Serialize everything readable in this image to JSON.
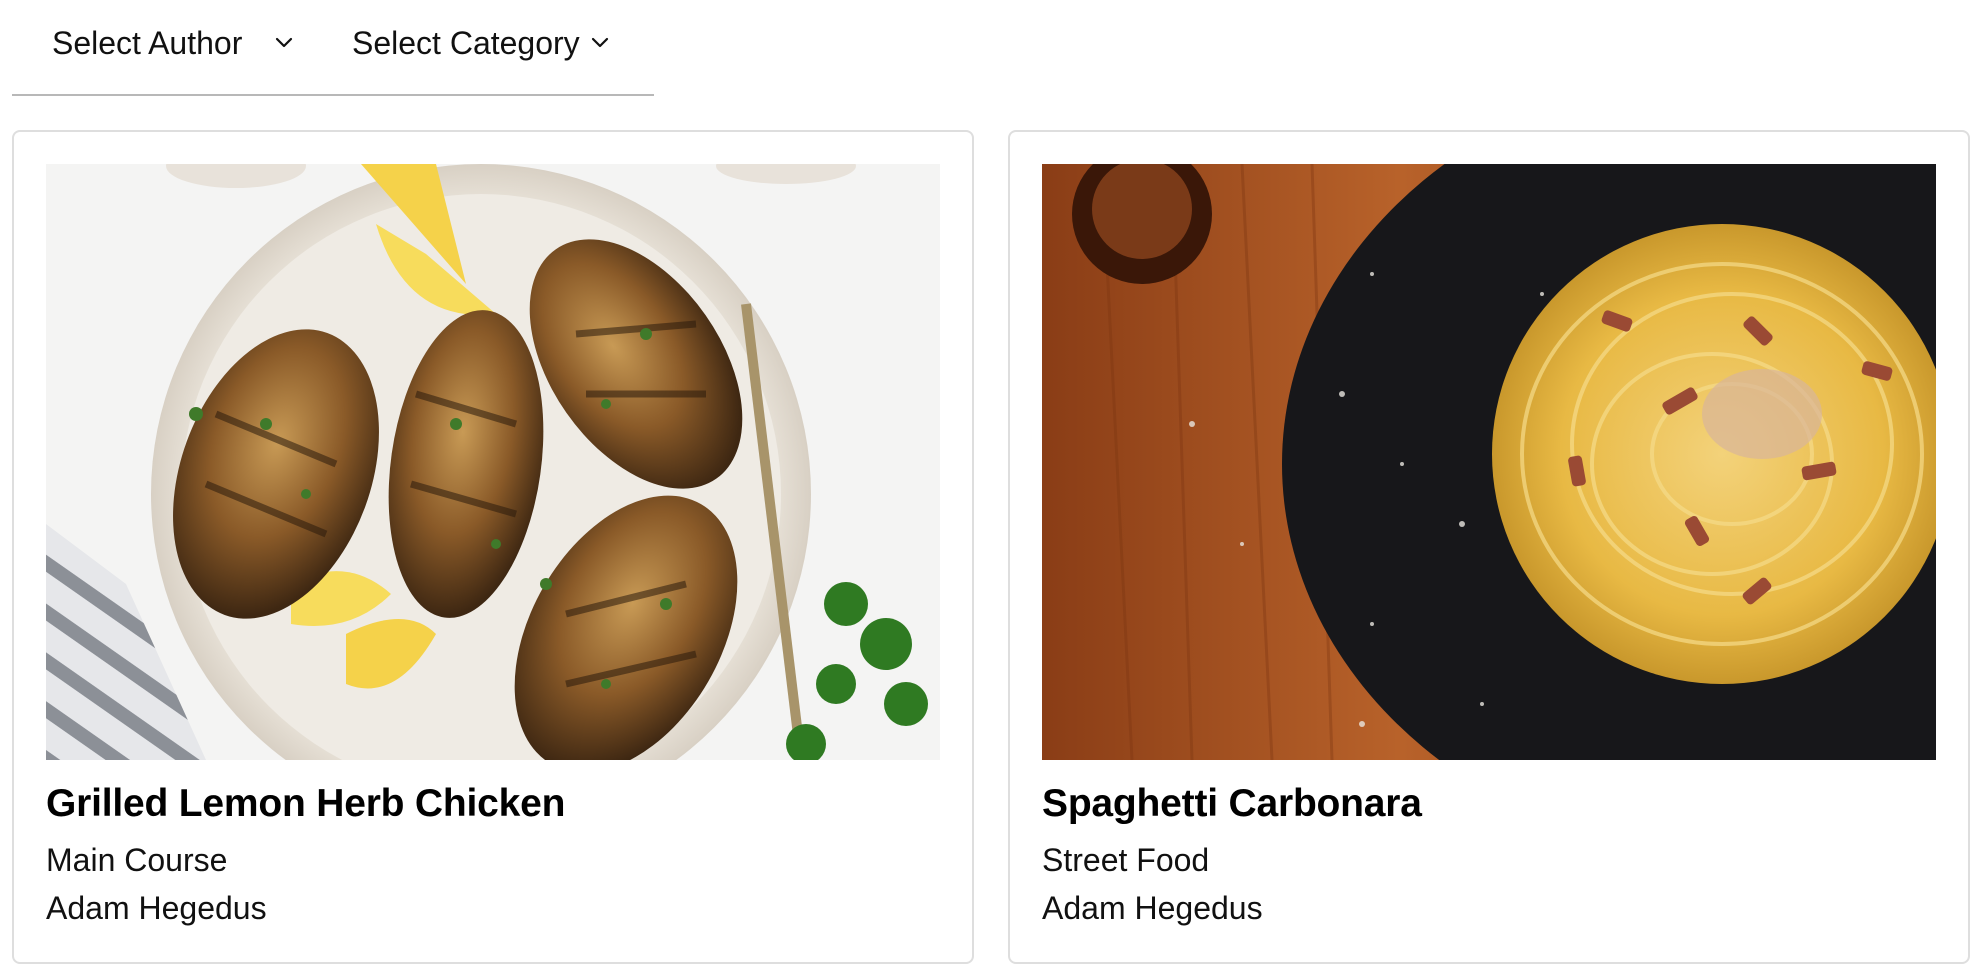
{
  "filters": {
    "author": {
      "label": "Select Author",
      "icon": "chevron-down-icon"
    },
    "category": {
      "label": "Select Category",
      "icon": "chevron-down-icon"
    }
  },
  "recipes": [
    {
      "title": "Grilled Lemon Herb Chicken",
      "category": "Main Course",
      "author": "Adam Hegedus"
    },
    {
      "title": "Spaghetti Carbonara",
      "category": "Street Food",
      "author": "Adam Hegedus"
    }
  ]
}
